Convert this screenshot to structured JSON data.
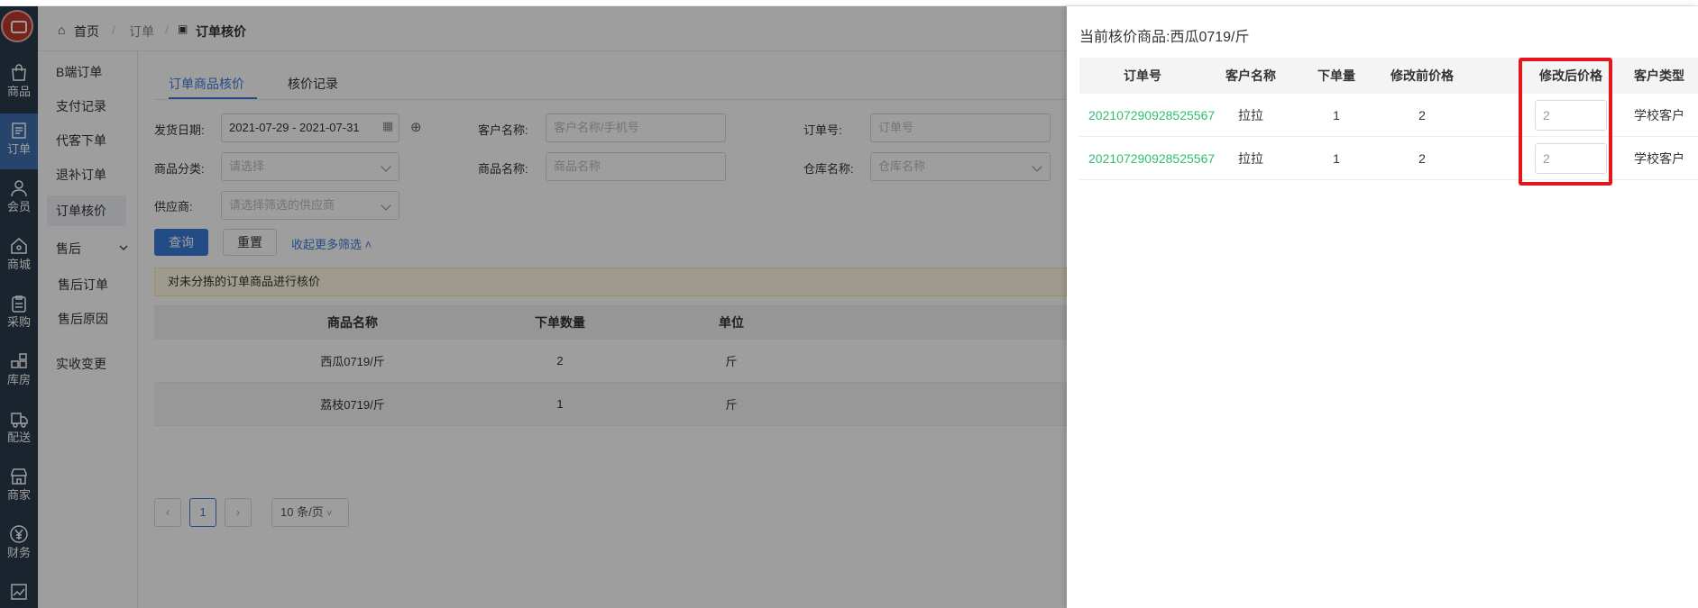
{
  "breadcrumb": {
    "home": "首页",
    "sep": "/",
    "level1": "订单",
    "current": "订单核价"
  },
  "leftnav": [
    {
      "label": "商品",
      "icon": "bag-icon"
    },
    {
      "label": "订单",
      "icon": "order-icon"
    },
    {
      "label": "会员",
      "icon": "user-icon"
    },
    {
      "label": "商城",
      "icon": "store-icon"
    },
    {
      "label": "采购",
      "icon": "clipboard-icon"
    },
    {
      "label": "库房",
      "icon": "warehouse-icon"
    },
    {
      "label": "配送",
      "icon": "truck-icon"
    },
    {
      "label": "商家",
      "icon": "shop-icon"
    },
    {
      "label": "财务",
      "icon": "yen-icon"
    }
  ],
  "subnav": {
    "items": [
      "B端订单",
      "支付记录",
      "代客下单",
      "退补订单",
      "订单核价",
      "售后",
      "售后订单",
      "售后原因",
      "实收变更"
    ]
  },
  "tabs": [
    "订单商品核价",
    "核价记录"
  ],
  "filters": {
    "ship_date_label": "发货日期:",
    "ship_date_value": "2021-07-29 - 2021-07-31",
    "customer_label": "客户名称:",
    "customer_placeholder": "客户名称/手机号",
    "order_no_label": "订单号:",
    "order_no_placeholder": "订单号",
    "category_label": "商品分类:",
    "category_placeholder": "请选择",
    "product_label": "商品名称:",
    "product_placeholder": "商品名称",
    "warehouse_label": "仓库名称:",
    "warehouse_placeholder": "仓库名称",
    "supplier_label": "供应商:",
    "supplier_placeholder": "请选择筛选的供应商"
  },
  "actions": {
    "query": "查询",
    "reset": "重置",
    "collapse": "收起更多筛选"
  },
  "notice": "对未分拣的订单商品进行核价",
  "grid": {
    "columns": [
      "商品名称",
      "下单数量",
      "单位"
    ],
    "rows": [
      [
        "西瓜0719/斤",
        "2",
        "斤"
      ],
      [
        "荔枝0719/斤",
        "1",
        "斤"
      ]
    ]
  },
  "pager": {
    "prev": "‹",
    "page": "1",
    "next": "›",
    "size": "10 条/页"
  },
  "drawer": {
    "title_label": "当前核价商品:",
    "title_value": "西瓜0719/斤",
    "columns": [
      "订单号",
      "客户名称",
      "下单量",
      "修改前价格",
      "修改后价格",
      "客户类型"
    ],
    "rows": [
      {
        "order_no": "202107290928525567",
        "customer": "拉拉",
        "qty": "1",
        "before": "2",
        "after": "2",
        "type": "学校客户"
      },
      {
        "order_no": "202107290928525567",
        "customer": "拉拉",
        "qty": "1",
        "before": "2",
        "after": "2",
        "type": "学校客户"
      }
    ]
  },
  "colors": {
    "nav_bg": "#2b3a4d",
    "accent": "#3a7bd5",
    "order_link": "#2fbf71",
    "highlight": "#e4161a"
  }
}
